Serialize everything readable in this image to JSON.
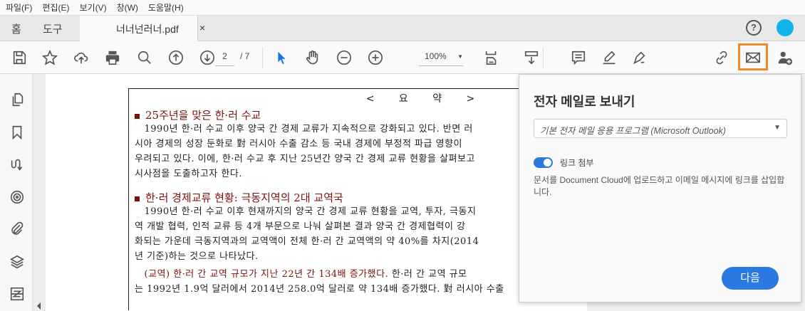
{
  "menu": [
    "파일(F)",
    "편집(E)",
    "보기(V)",
    "창(W)",
    "도움말(H)"
  ],
  "tabs": {
    "home": "홈",
    "tools": "도구",
    "document": "너너넌러너.pdf",
    "close": "×"
  },
  "toolbar": {
    "page_current": "2",
    "page_total": "/ 7",
    "zoom": "100%",
    "zoom_arrow": "▼"
  },
  "document": {
    "title": "< 요 약 >",
    "sections": [
      {
        "heading": "25주년을 맞은 한·러 수교",
        "lines": [
          "　1990년 한·러 수교 이후 양국 간 경제 교류가 지속적으로 강화되고 있다. 반면 러",
          "시아 경제의 성장 둔화로 對 러시아 수출 감소 등 국내 경제에 부정적 파급 영향이",
          "우려되고 있다. 이에, 한·러 수교 후 지난 25년간 양국 간 경제 교류 현황을 살펴보고",
          "시사점을 도출하고자 한다."
        ]
      },
      {
        "heading": "한·러 경제교류 현황: 극동지역의 2대 교역국",
        "lines": [
          "　1990년 한·러 수교 이후 현재까지의 양국 간 경제 교류 현황을 교역, 투자, 극동지",
          "역 개발 협력, 인적 교류 등 4개 부문으로 나눠 살펴본 결과 양국 간 경제협력이 강",
          "화되는 가운데 극동지역과의 교역액이 전체 한·러 간 교역액의 약 40%를 차지(2014",
          "년 기준)하는 것으로 나타났다."
        ],
        "highlight": "　(교역) 한·러 간 교역 규모가 지난 22년 간 134배 증가했다.",
        "highlight_rest": " 한·러 간 교역 규모",
        "more": [
          "는 1992년 1.9억 달러에서 2014년 258.0억 달러로 약 134배 증가했다. 對 러시아 수출"
        ]
      }
    ]
  },
  "email_panel": {
    "title": "전자 메일로 보내기",
    "select_value": "기본 전자 메일 응용 프로그램 (Microsoft Outlook)",
    "select_arrow": "▼",
    "toggle_label": "링크 첨부",
    "toggle_on": true,
    "description": "문서를 Document Cloud에 업로드하고 이메일 메시지에 링크를 삽입합니다.",
    "next_button": "다음"
  },
  "colors": {
    "accent": "#2a7ae2",
    "highlight_box": "#f08a24",
    "heading": "#7a1010",
    "avatar": "#0fb4e8"
  }
}
